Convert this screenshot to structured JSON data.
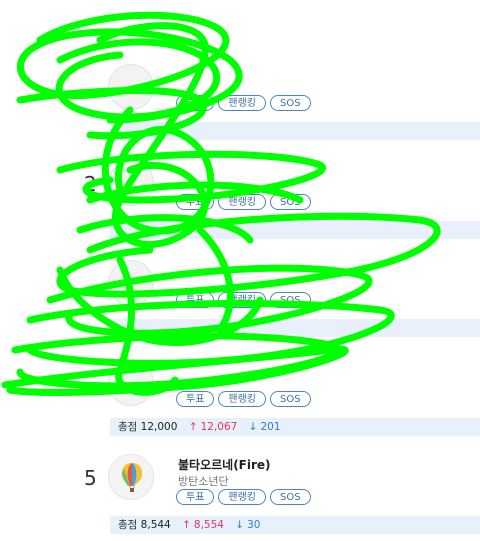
{
  "buttons": {
    "vote": "투표",
    "fan_rank": "팬랭킹",
    "sos": "SOS"
  },
  "total_label": "총점",
  "entries": [
    {
      "rank": "",
      "title": "",
      "artist": "",
      "total": "",
      "up": "",
      "down": ""
    },
    {
      "rank": "2",
      "title": "",
      "artist": "",
      "total": "",
      "up": "",
      "down": ""
    },
    {
      "rank": "",
      "title": "",
      "artist": "",
      "total": "",
      "up": "",
      "down": ""
    },
    {
      "rank": "",
      "title": "",
      "artist": "",
      "total": "12,000",
      "up": "12,067",
      "down": "201"
    },
    {
      "rank": "5",
      "title": "불타오르네(Fire)",
      "artist": "방탄소년단",
      "total": "8,544",
      "up": "8,554",
      "down": "30"
    }
  ],
  "colors": {
    "scribble": "#00ff00",
    "accent": "#4a86c5",
    "score_bg": "#e8f1fb",
    "up": "#e0356a",
    "down": "#2a7fd0"
  },
  "icons": {
    "up": "arrow-up-icon",
    "down": "arrow-down-icon",
    "album": "hot-air-balloon-icon"
  }
}
